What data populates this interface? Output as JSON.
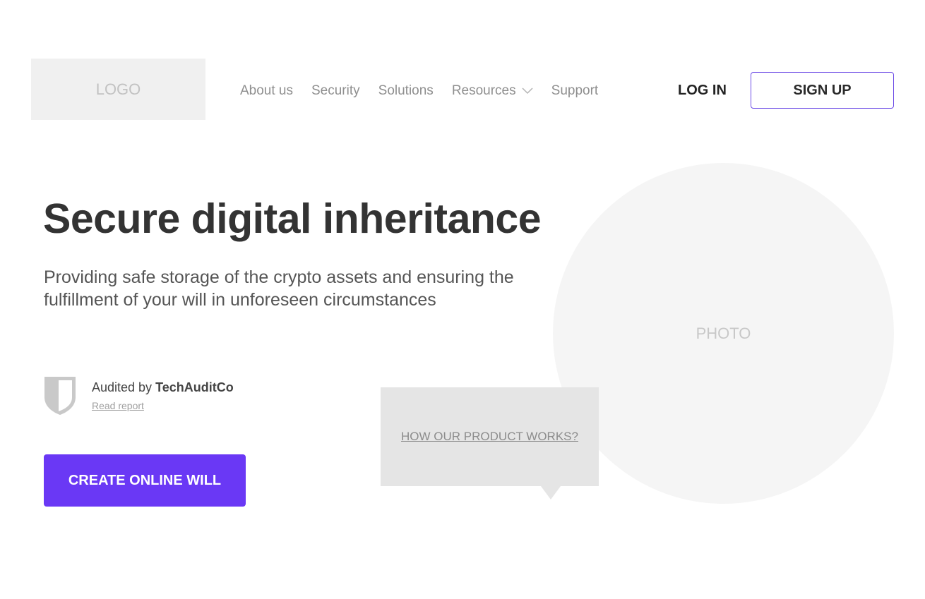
{
  "header": {
    "logo_text": "LOGO",
    "nav": {
      "about": "About us",
      "security": "Security",
      "solutions": "Solutions",
      "resources": "Resources",
      "support": "Support"
    },
    "login_label": "LOG IN",
    "signup_label": "SIGN UP"
  },
  "hero": {
    "title": "Secure digital inheritance",
    "subtitle": "Providing safe storage of the crypto assets and ensuring the fulfillment of your will in unforeseen circumstances",
    "audit": {
      "prefix": "Audited by ",
      "auditor": "TechAuditCo",
      "link_label": "Read report"
    },
    "cta_label": "CREATE ONLINE WILL"
  },
  "media": {
    "photo_label": "PHOTO",
    "video_link_label": "HOW OUR PRODUCT WORKS?"
  },
  "colors": {
    "accent": "#6a38f5",
    "signup_border": "#6d4ce6"
  },
  "icons": {
    "audit": "shield-icon",
    "resources_dropdown": "chevron-down-icon"
  }
}
